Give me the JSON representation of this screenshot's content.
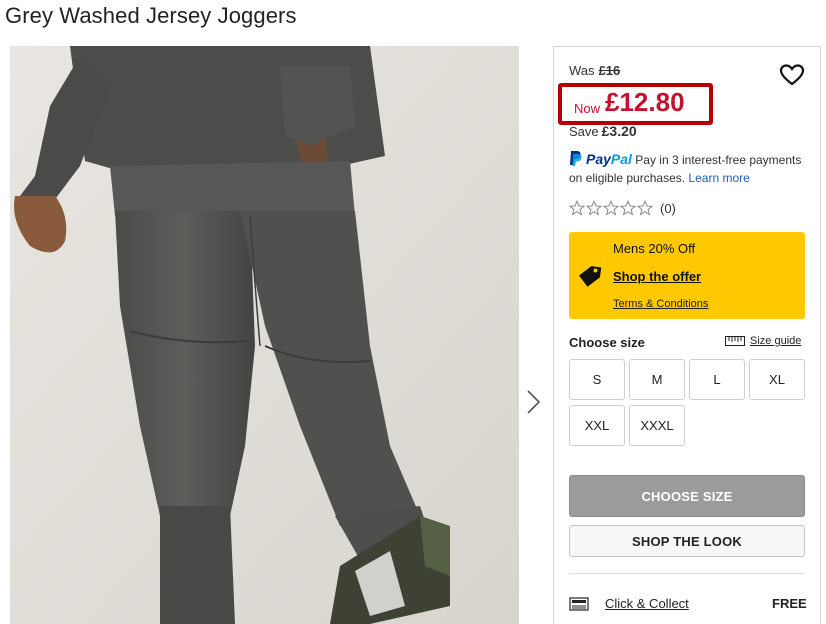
{
  "product": {
    "title": "Grey Washed Jersey Joggers",
    "image_alt": "Grey washed jersey joggers worn by model"
  },
  "price": {
    "was_label": "Was",
    "was_value": "£16",
    "now_label": "Now",
    "now_value": "£12.80",
    "save_label": "Save",
    "save_value": "£3.20",
    "accent_color": "#c8102e",
    "highlight_border": "#b40000"
  },
  "paypal": {
    "brand_pay": "Pay",
    "brand_pal": "Pal",
    "message": "Pay in 3 interest-free payments on eligible purchases.",
    "learn_more": "Learn more"
  },
  "rating": {
    "stars_filled": 0,
    "stars_total": 5,
    "count": "(0)"
  },
  "offer": {
    "title": "Mens 20% Off",
    "link": "Shop the offer",
    "terms": "Terms & Conditions",
    "background": "#ffc800",
    "icon": "tag-icon"
  },
  "sizes": {
    "label": "Choose size",
    "guide": "Size guide",
    "options": [
      "S",
      "M",
      "L",
      "XL",
      "XXL",
      "XXXL"
    ]
  },
  "actions": {
    "choose_size": "CHOOSE SIZE",
    "shop_the_look": "SHOP THE LOOK"
  },
  "delivery": {
    "click_collect": "Click & Collect",
    "price": "FREE"
  },
  "icons": {
    "wishlist": "heart-icon",
    "next": "chevron-right-icon",
    "ruler": "ruler-icon",
    "store": "store-icon",
    "star": "star-outline-icon"
  }
}
